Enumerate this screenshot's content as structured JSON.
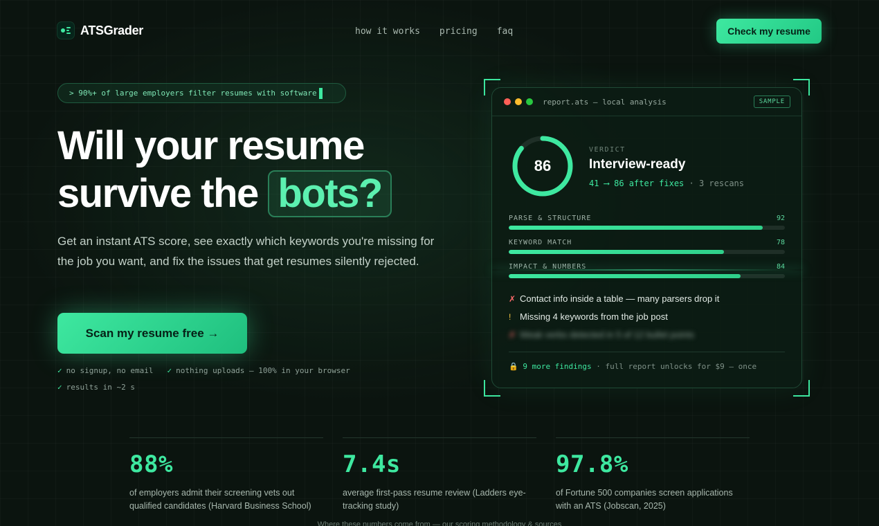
{
  "nav": {
    "brand": "ATSGrader",
    "links": [
      "how it works",
      "pricing",
      "faq"
    ],
    "cta": "Check my resume"
  },
  "hero": {
    "pill": "> 90%+ of large employers filter resumes with software",
    "headline_line1": "Will your resume",
    "headline_line2": "survive the",
    "headline_highlight": "bots?",
    "subtitle": "Get an instant ATS score, see exactly which keywords you're missing for the job you want, and fix the issues that get resumes silently rejected.",
    "cta": "Scan my resume free →",
    "checks": [
      "no signup, no email",
      "nothing uploads — 100% in your browser",
      "results in ~2 s"
    ],
    "check_mark": "✓"
  },
  "report": {
    "title": "report.ats — local analysis",
    "badge": "SAMPLE",
    "score": 86,
    "score_max": 100,
    "verdict_label": "VERDICT",
    "verdict": "Interview-ready",
    "verdict_sub": "41 ⟶ 86 after fixes",
    "verdict_rescans": "· 3 rescans",
    "metrics": [
      {
        "label": "PARSE & STRUCTURE",
        "value": 92
      },
      {
        "label": "KEYWORD MATCH",
        "value": 78
      },
      {
        "label": "IMPACT & NUMBERS",
        "value": 84
      }
    ],
    "findings": [
      {
        "icon": "✗",
        "color": "#ff6b6b",
        "text": "Contact info inside a table — many parsers drop it"
      },
      {
        "icon": "!",
        "color": "#f5c542",
        "text": "Missing 4 keywords from the job post"
      },
      {
        "icon": "✗",
        "color": "#ff6b6b",
        "text": "Weak verbs detected in 5 of 12 bullet points"
      }
    ],
    "more_findings": "9 more findings",
    "unlock": "· full report unlocks for $9 — once",
    "lock_icon": "🔒"
  },
  "stats": [
    {
      "value": "88%",
      "desc": "of employers admit their screening vets out qualified candidates (Harvard Business School)"
    },
    {
      "value": "7.4s",
      "desc": "average first-pass resume review (Ladders eye-tracking study)"
    },
    {
      "value": "97.8%",
      "desc": "of Fortune 500 companies screen applications with an ATS (Jobscan, 2025)"
    }
  ],
  "methodology": "Where these numbers come from — our scoring methodology & sources",
  "colors": {
    "accent": "#3ee8a0",
    "background": "#0b140f",
    "danger": "#ff6b6b",
    "warning": "#f5c542"
  }
}
